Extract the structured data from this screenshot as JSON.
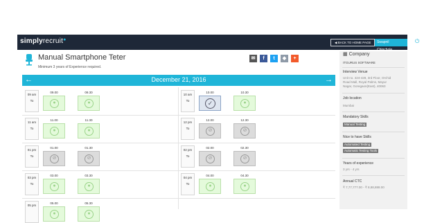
{
  "header": {
    "logo_a": "simply",
    "logo_b": "recruit",
    "back_label": "◀  BACK TO HOME PAGE",
    "user_label": "Swapnil Chinchole"
  },
  "job": {
    "title": "Manual Smartphone Teter",
    "subtitle": "Minimum 3 years of Experience required."
  },
  "date": "December 21, 2016",
  "slots": [
    {
      "from": "09 am",
      "to": "10 am",
      "times": [
        "09.00",
        "09.30"
      ]
    },
    {
      "from": "10 am",
      "to": "11 am",
      "times": [
        "10.00",
        "10.30"
      ]
    },
    {
      "from": "11 am",
      "to": "12 pm",
      "times": [
        "11.00",
        "11.30"
      ]
    },
    {
      "from": "12 pm",
      "to": "01 pm",
      "times": [
        "12.00",
        "12.30"
      ]
    },
    {
      "from": "01 pm",
      "to": "02 pm",
      "times": [
        "01.00",
        "01.30"
      ]
    },
    {
      "from": "02 pm",
      "to": "03 pm",
      "times": [
        "02.00",
        "02.30"
      ]
    },
    {
      "from": "03 pm",
      "to": "04 pm",
      "times": [
        "03.00",
        "03.30"
      ]
    },
    {
      "from": "04 pm",
      "to": "05 pm",
      "times": [
        "04.00",
        "04.30"
      ]
    },
    {
      "from": "05 pm",
      "to": "",
      "times": [
        "05.00",
        "05.30"
      ]
    }
  ],
  "sidebar": {
    "company_heading": "Company",
    "company_name": "ITGURUS SOFTWARE",
    "venue_label": "Interview Venue",
    "venue_lines": [
      "Unit no. 424-428, 3rd Floor, Orchid",
      "Road Mall, Royal Palms, Mayur",
      "Nagar, Goregaon(East), 40063"
    ],
    "location_label": "Job location",
    "location": "Mumbai",
    "mandatory_label": "Mandatory Skills",
    "mandatory_skills": [
      "Manual Testing"
    ],
    "nice_label": "Nice to have Skills",
    "nice_skills": [
      "Automated Testing",
      "Automatic Testing Tools"
    ],
    "experience_label": "Years of experience",
    "experience": "3 yrs - 4 yrs",
    "ctc_label": "Annual CTC",
    "ctc": "₹ 7,77,777.00  -  ₹ 8,88,888.00"
  },
  "colors": {
    "accent": "#1fb5d8",
    "topbar": "#1e2838",
    "available": "#e4fadb",
    "booked": "#dcdcdc"
  }
}
